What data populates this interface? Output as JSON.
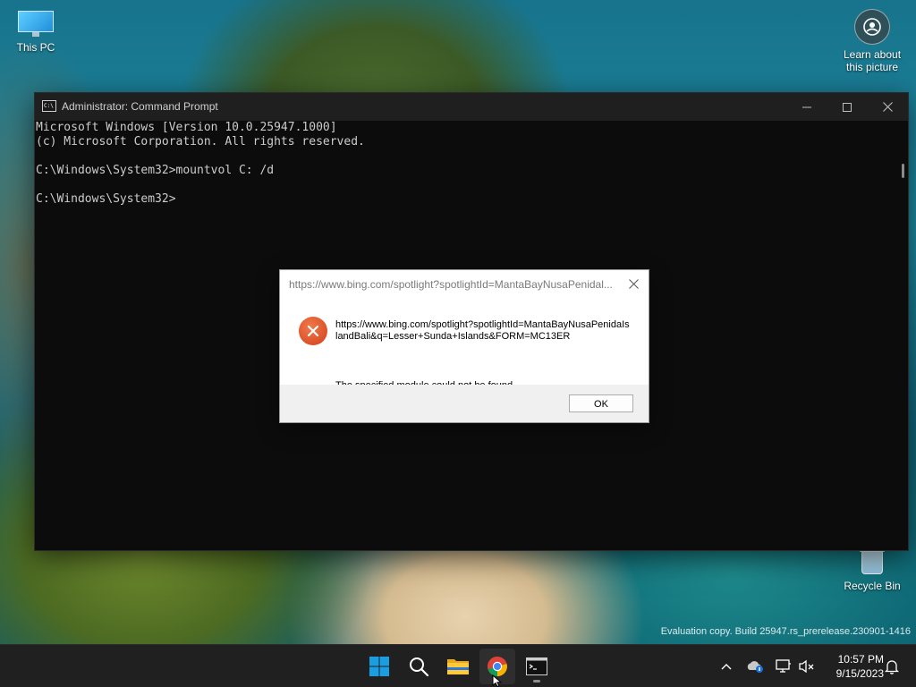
{
  "desktop": {
    "icons": {
      "this_pc": "This PC",
      "learn": "Learn about this picture",
      "recycle_bin": "Recycle Bin"
    },
    "watermark": "Evaluation copy. Build 25947.rs_prerelease.230901-1416"
  },
  "cmd": {
    "title": "Administrator: Command Prompt",
    "lines": [
      "Microsoft Windows [Version 10.0.25947.1000]",
      "(c) Microsoft Corporation. All rights reserved.",
      "",
      "C:\\Windows\\System32>mountvol C: /d",
      "",
      "C:\\Windows\\System32>"
    ]
  },
  "dialog": {
    "title": "https://www.bing.com/spotlight?spotlightId=MantaBayNusaPenidal...",
    "message": "https://www.bing.com/spotlight?spotlightId=MantaBayNusaPenidaIslandBali&q=Lesser+Sunda+Islands&FORM=MC13ER",
    "detail": "The specified module could not be found.",
    "ok_label": "OK"
  },
  "taskbar": {
    "pinned": [
      "start-icon",
      "search-icon",
      "file-explorer-icon",
      "chrome-icon",
      "terminal-icon"
    ],
    "clock": {
      "time": "10:57 PM",
      "date": "9/15/2023"
    }
  },
  "colors": {
    "cmd_bg": "#0c0c0c",
    "cmd_text": "#cccccc",
    "taskbar_bg": "#202020",
    "error_red": "#d33e1a",
    "win_blue": "#1b9de2"
  }
}
